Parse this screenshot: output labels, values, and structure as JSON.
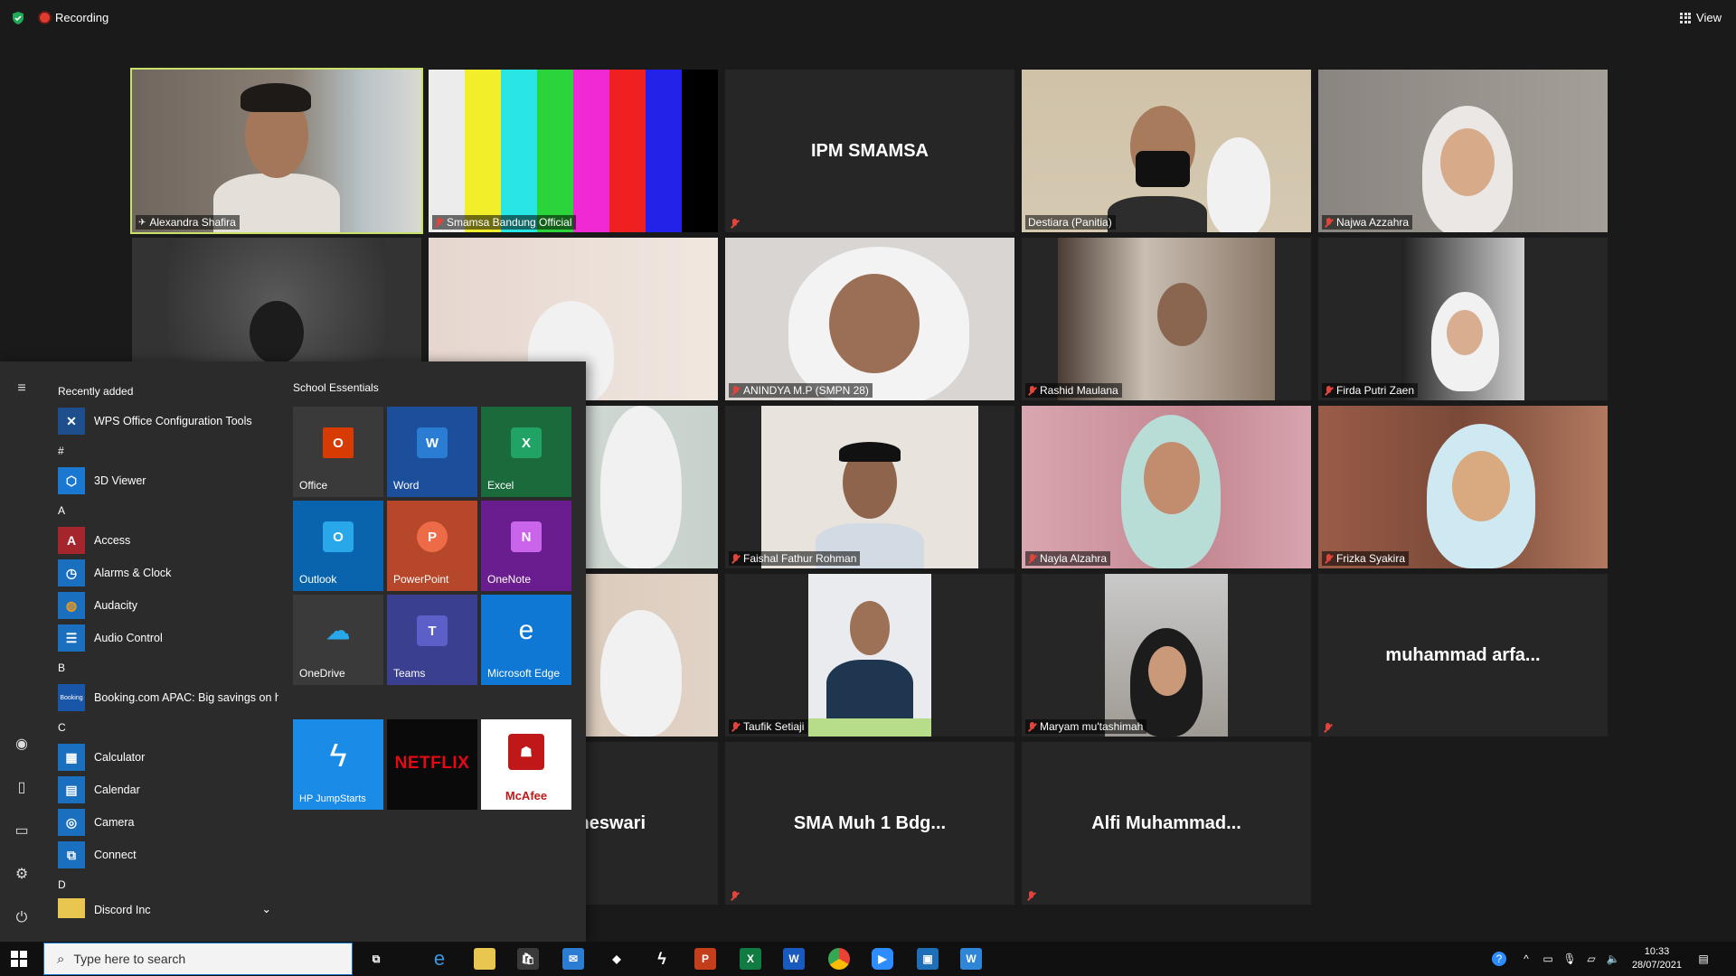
{
  "topbar": {
    "recording_label": "Recording",
    "view_label": "View"
  },
  "participants": [
    {
      "name": "Alexandra Shafira",
      "muted": false,
      "active": true
    },
    {
      "name": "Smamsa Bandung Official",
      "muted": true
    },
    {
      "name": "IPM SMAMSA",
      "muted": true,
      "no_video": true
    },
    {
      "name": "Destiara (Panitia)",
      "muted": false
    },
    {
      "name": "Najwa Azzahra",
      "muted": true
    },
    {
      "name": "ANINDYA M.P (SMPN 28)",
      "muted": true
    },
    {
      "name": "Rashid Maulana",
      "muted": true
    },
    {
      "name": "Firda Putri Zaen",
      "muted": true
    },
    {
      "name": "Faishal Fathur Rohman",
      "muted": true
    },
    {
      "name": "Nayla Alzahra",
      "muted": true
    },
    {
      "name": "Frizka Syakira",
      "muted": true
    },
    {
      "name": "Taufik Setiaji",
      "muted": true
    },
    {
      "name": "Maryam mu'tashimah",
      "muted": true
    },
    {
      "name": "muhammad arfa...",
      "muted": true,
      "no_video": true
    },
    {
      "name": "neswari",
      "muted": true,
      "no_video": true
    },
    {
      "name": "SMA Muh 1 Bdg...",
      "muted": true,
      "no_video": true
    },
    {
      "name": "Alfi Muhammad...",
      "muted": true,
      "no_video": true
    }
  ],
  "start_menu": {
    "recently_added_header": "Recently added",
    "recent_app": "WPS Office Configuration Tools",
    "groups": [
      {
        "letter": "#",
        "apps": [
          "3D Viewer"
        ]
      },
      {
        "letter": "A",
        "apps": [
          "Access",
          "Alarms & Clock",
          "Audacity",
          "Audio Control"
        ]
      },
      {
        "letter": "B",
        "apps": [
          "Booking.com APAC: Big savings on h..."
        ]
      },
      {
        "letter": "C",
        "apps": [
          "Calculator",
          "Calendar",
          "Camera",
          "Connect"
        ]
      },
      {
        "letter": "D",
        "apps": [
          "Discord Inc"
        ]
      }
    ],
    "tiles_header": "School Essentials",
    "tiles": [
      "Office",
      "Word",
      "Excel",
      "Outlook",
      "PowerPoint",
      "OneNote",
      "OneDrive",
      "Teams",
      "Microsoft Edge"
    ],
    "promo_tiles": [
      "HP JumpStarts",
      "NETFLIX",
      "McAfee"
    ]
  },
  "taskbar": {
    "search_placeholder": "Type here to search",
    "time": "10:33",
    "date": "28/07/2021"
  },
  "colors": {
    "active_speaker": "#c9e06a",
    "taskbar": "#101010",
    "start_bg": "#2b2b2b"
  }
}
